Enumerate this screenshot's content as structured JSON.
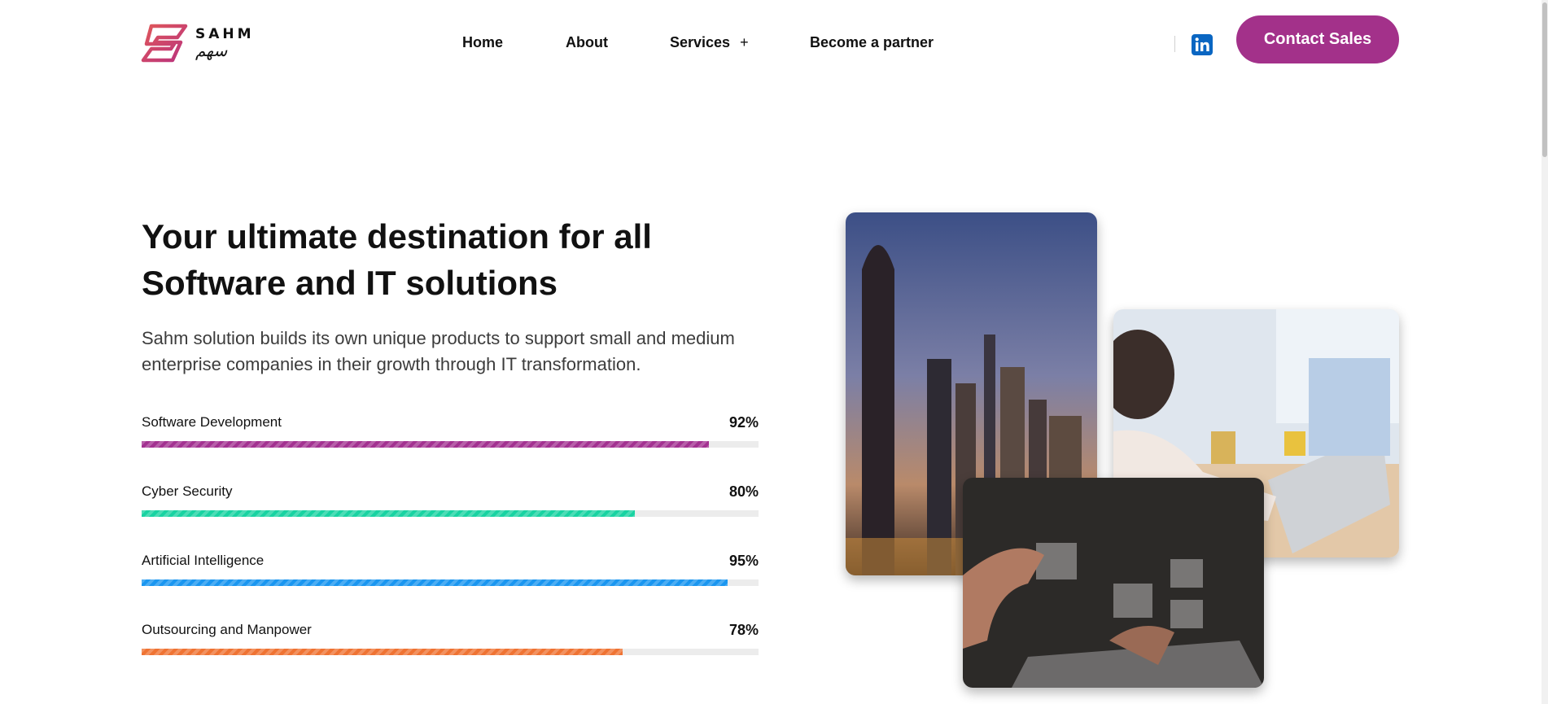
{
  "brand": {
    "name_en": "SAHM",
    "name_ar": "سهم",
    "colors": {
      "primary": "#a3318a",
      "logo_gradient": [
        "#d94f5c",
        "#c13a7c"
      ]
    }
  },
  "nav": {
    "items": [
      {
        "label": "Home"
      },
      {
        "label": "About"
      },
      {
        "label": "Services",
        "expand_icon": "+"
      },
      {
        "label": "Become a partner"
      }
    ],
    "social_icon": "linkedin-icon",
    "cta_label": "Contact Sales"
  },
  "hero": {
    "title_line1": "Your ultimate destination for all",
    "title_line2": "Software and IT solutions",
    "description": "Sahm solution builds its own unique products to support small and medium enterprise companies in their growth through IT transformation."
  },
  "skills": [
    {
      "label": "Software Development",
      "percent_text": "92%",
      "value": 92,
      "color": "#a33291"
    },
    {
      "label": "Cyber Security",
      "percent_text": "80%",
      "value": 80,
      "color": "#19d3a2"
    },
    {
      "label": "Artificial Intelligence",
      "percent_text": "95%",
      "value": 95,
      "color": "#1a96f0"
    },
    {
      "label": "Outsourcing and Manpower",
      "percent_text": "78%",
      "value": 78,
      "color": "#ef7333"
    }
  ]
}
